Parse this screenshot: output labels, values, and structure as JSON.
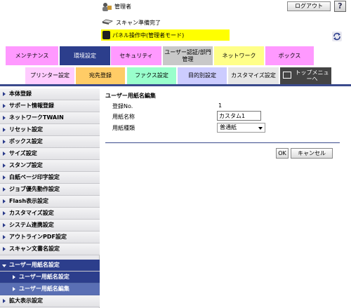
{
  "header": {
    "user_icon": "admin-user-icon",
    "user_label": "管理者",
    "logout_label": "ログアウト",
    "help_label": "?",
    "status_icon": "scanner-icon",
    "status_text": "スキャン準備完了",
    "panel_icon": "panel-device-icon",
    "panel_text": "パネル操作中(管理者モード)",
    "refresh_icon": "refresh-icon"
  },
  "tabs_primary": [
    {
      "label": "メンテナンス",
      "color": "#ff99ff"
    },
    {
      "label": "環境設定",
      "color": "#2c3e8c",
      "active": true
    },
    {
      "label": "セキュリティ",
      "color": "#ff99ff"
    },
    {
      "label": "ユーザー認証/部門管理",
      "color": "#c8c8c8"
    },
    {
      "label": "ネットワーク",
      "color": "#ffff88"
    },
    {
      "label": "ボックス",
      "color": "#ff99ff"
    }
  ],
  "tabs_secondary": [
    {
      "label": "プリンター設定",
      "color": "#ffccff"
    },
    {
      "label": "宛先登録",
      "color": "#ffcc66"
    },
    {
      "label": "ファクス設定",
      "color": "#99ffcc"
    },
    {
      "label": "目的別設定",
      "color": "#ccccff"
    },
    {
      "label": "カスタマイズ設定",
      "color": "#e6e6e6"
    },
    {
      "label": "トップメニューへ",
      "color": "#444444"
    }
  ],
  "sidebar": {
    "items": [
      {
        "label": "本体登録"
      },
      {
        "label": "サポート情報登録"
      },
      {
        "label": "ネットワークTWAIN"
      },
      {
        "label": "リセット設定"
      },
      {
        "label": "ボックス設定"
      },
      {
        "label": "サイズ設定"
      },
      {
        "label": "スタンプ設定"
      },
      {
        "label": "白紙ページ印字設定"
      },
      {
        "label": "ジョブ優先動作設定"
      },
      {
        "label": "Flash表示設定"
      },
      {
        "label": "カスタマイズ設定"
      },
      {
        "label": "システム連携設定"
      },
      {
        "label": "アウトラインPDF設定"
      },
      {
        "label": "スキャン文書名設定"
      },
      {
        "label": "ユーザー用紙名設定"
      }
    ],
    "subitems": [
      {
        "label": "ユーザー用紙名設定"
      },
      {
        "label": "ユーザー用紙名編集"
      }
    ],
    "last_item": {
      "label": "拡大表示設定"
    }
  },
  "main": {
    "title": "ユーザー用紙名編集",
    "reg_no_label": "登録No.",
    "reg_no_value": "1",
    "paper_name_label": "用紙名称",
    "paper_name_value": "カスタム1",
    "paper_type_label": "用紙種類",
    "paper_type_value": "普通紙",
    "ok_label": "OK",
    "cancel_label": "キャンセル"
  }
}
